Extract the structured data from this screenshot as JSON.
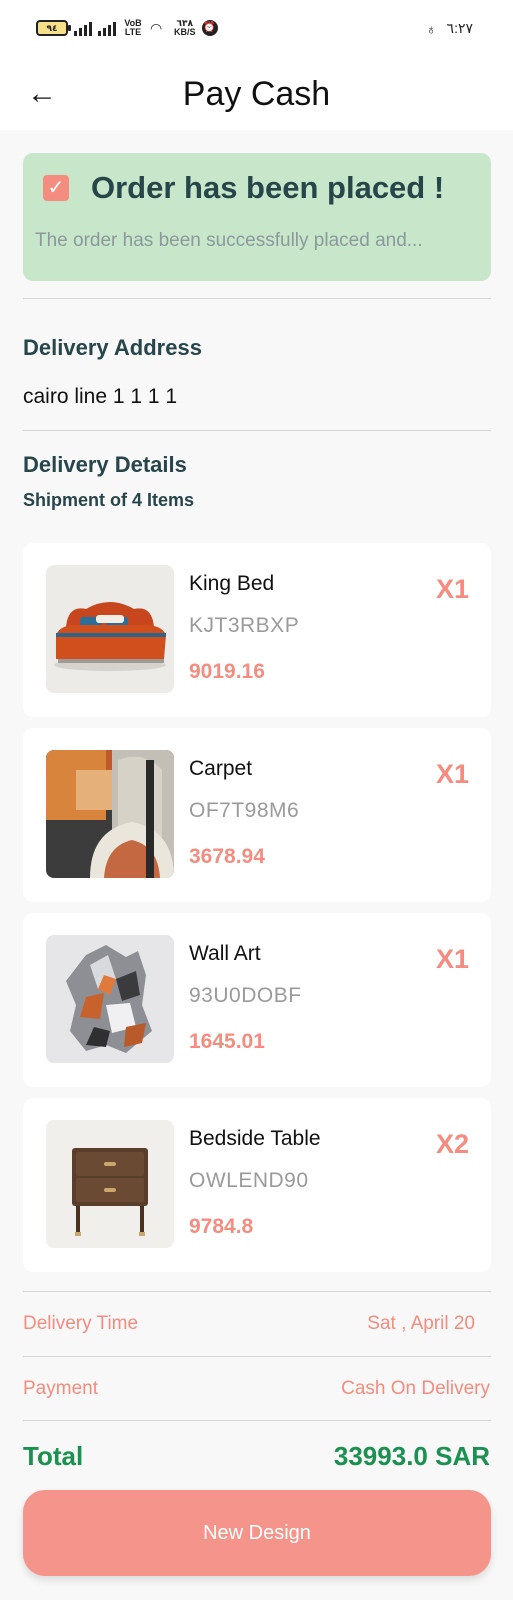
{
  "status_bar": {
    "battery": "٩٤",
    "network_label": "VoB LTE",
    "speed_value": "٦٣٨",
    "speed_unit": "KB/S",
    "time": "٦:٢٧"
  },
  "app_bar": {
    "title": "Pay Cash",
    "back_icon": "arrow-left-icon"
  },
  "banner": {
    "title": "Order has been placed !",
    "subtitle": "The order has been successfully placed and..."
  },
  "delivery_address": {
    "heading": "Delivery Address",
    "value": "cairo line 1 1 1 1"
  },
  "delivery_details": {
    "heading": "Delivery Details",
    "shipment": "Shipment of 4 Items"
  },
  "items": [
    {
      "name": "King Bed",
      "code": "KJT3RBXP",
      "price": "9019.16",
      "qty": "X1",
      "image": "bed-image"
    },
    {
      "name": "Carpet",
      "code": "OF7T98M6",
      "price": "3678.94",
      "qty": "X1",
      "image": "carpet-image"
    },
    {
      "name": "Wall Art",
      "code": "93U0DOBF",
      "price": "1645.01",
      "qty": "X1",
      "image": "wall-art-image"
    },
    {
      "name": "Bedside Table",
      "code": "OWLEND90",
      "price": "9784.8",
      "qty": "X2",
      "image": "bedside-table-image"
    }
  ],
  "summary": {
    "delivery_time_label": "Delivery Time",
    "delivery_time_value": "Sat , April 20",
    "payment_label": "Payment",
    "payment_value": "Cash On Delivery",
    "total_label": "Total",
    "total_value": "33993.0 SAR"
  },
  "actions": {
    "new_design_label": "New Design"
  },
  "colors": {
    "accent": "#f48c7f",
    "banner_bg": "#c8e6c9",
    "heading": "#28464a",
    "total": "#1a9150"
  }
}
